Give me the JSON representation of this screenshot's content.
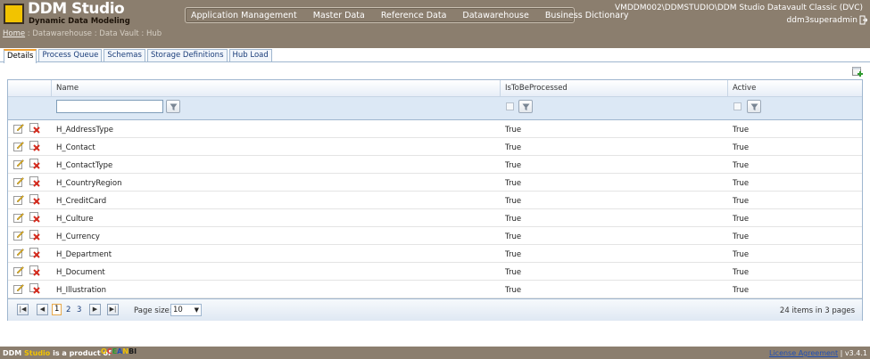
{
  "header": {
    "brand": "DDM Studio",
    "tagline": "Dynamic Data Modeling",
    "nav": [
      "Application Management",
      "Master Data",
      "Reference Data",
      "Datawarehouse",
      "Business Dictionary"
    ],
    "server": "VMDDM002\\DDMSTUDIO\\DDM Studio Datavault Classic (DVC)",
    "user": "ddm3superadmin"
  },
  "breadcrumb": {
    "home": "Home",
    "rest": " : Datawarehouse : Data Vault : Hub"
  },
  "tabs": [
    "Details",
    "Process Queue",
    "Schemas",
    "Storage Definitions",
    "Hub Load"
  ],
  "grid": {
    "columns": [
      "Name",
      "IsToBeProcessed",
      "Active"
    ],
    "filter_value": "",
    "rows": [
      {
        "name": "H_AddressType",
        "processed": "True",
        "active": "True"
      },
      {
        "name": "H_Contact",
        "processed": "True",
        "active": "True"
      },
      {
        "name": "H_ContactType",
        "processed": "True",
        "active": "True"
      },
      {
        "name": "H_CountryRegion",
        "processed": "True",
        "active": "True"
      },
      {
        "name": "H_CreditCard",
        "processed": "True",
        "active": "True"
      },
      {
        "name": "H_Culture",
        "processed": "True",
        "active": "True"
      },
      {
        "name": "H_Currency",
        "processed": "True",
        "active": "True"
      },
      {
        "name": "H_Department",
        "processed": "True",
        "active": "True"
      },
      {
        "name": "H_Document",
        "processed": "True",
        "active": "True"
      },
      {
        "name": "H_Illustration",
        "processed": "True",
        "active": "True"
      }
    ]
  },
  "pager": {
    "pages": [
      "1",
      "2",
      "3"
    ],
    "page_size_label": "Page size:",
    "page_size": "10",
    "info": "24 items in 3 pages"
  },
  "footer": {
    "prefix": "DDM",
    "studio": "Studio",
    "suffix": "is a product of",
    "company": "OCEANBI",
    "license": "License Agreement",
    "version": "| v3.4.1"
  },
  "colors": {
    "header_bg": "#8b7e6e",
    "accent_yellow": "#f2c300",
    "grid_border": "#9fb6cf",
    "tab_active_top": "#f0a030"
  }
}
